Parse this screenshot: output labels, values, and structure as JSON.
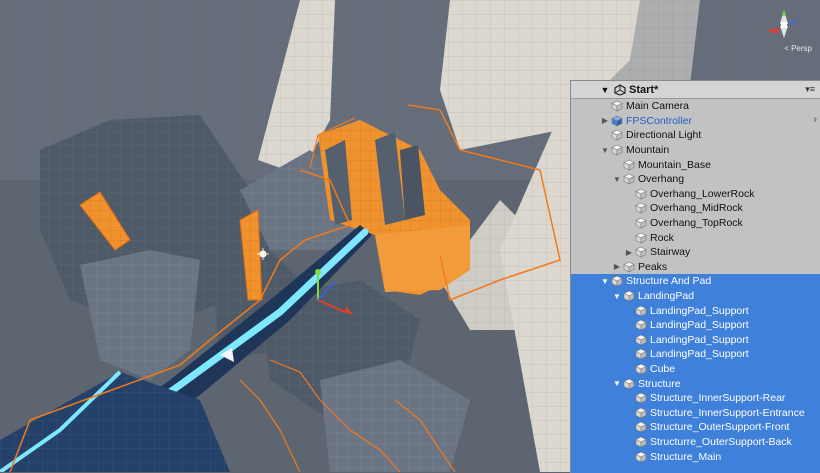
{
  "scene_view": {
    "gizmo_label": "< Persp",
    "colors": {
      "background": "#5f6670",
      "rock_light": "#dedad3",
      "rock_dark": "#4e5866",
      "selection_outline": "#f07a1e",
      "selected_fill": "#f0932e",
      "path_glow": "#7ee8ff"
    }
  },
  "hierarchy": {
    "scene_name": "Start*",
    "items": [
      {
        "label": "Main Camera",
        "depth": 1,
        "arrow": "",
        "selected": false,
        "prefab": false
      },
      {
        "label": "FPSController",
        "depth": 1,
        "arrow": "▶",
        "selected": false,
        "prefab": true
      },
      {
        "label": "Directional Light",
        "depth": 1,
        "arrow": "",
        "selected": false,
        "prefab": false
      },
      {
        "label": "Mountain",
        "depth": 1,
        "arrow": "▼",
        "selected": false,
        "prefab": false
      },
      {
        "label": "Mountain_Base",
        "depth": 2,
        "arrow": "",
        "selected": false,
        "prefab": false
      },
      {
        "label": "Overhang",
        "depth": 2,
        "arrow": "▼",
        "selected": false,
        "prefab": false
      },
      {
        "label": "Overhang_LowerRock",
        "depth": 3,
        "arrow": "",
        "selected": false,
        "prefab": false
      },
      {
        "label": "Overhang_MidRock",
        "depth": 3,
        "arrow": "",
        "selected": false,
        "prefab": false
      },
      {
        "label": "Overhang_TopRock",
        "depth": 3,
        "arrow": "",
        "selected": false,
        "prefab": false
      },
      {
        "label": "Rock",
        "depth": 3,
        "arrow": "",
        "selected": false,
        "prefab": false
      },
      {
        "label": "Stairway",
        "depth": 3,
        "arrow": "▶",
        "selected": false,
        "prefab": false
      },
      {
        "label": "Peaks",
        "depth": 2,
        "arrow": "▶",
        "selected": false,
        "prefab": false
      },
      {
        "label": "Structure And Pad",
        "depth": 1,
        "arrow": "▼",
        "selected": true,
        "prefab": false
      },
      {
        "label": "LandingPad",
        "depth": 2,
        "arrow": "▼",
        "selected": true,
        "prefab": false
      },
      {
        "label": "LandingPad_Support",
        "depth": 3,
        "arrow": "",
        "selected": true,
        "prefab": false
      },
      {
        "label": "LandingPad_Support",
        "depth": 3,
        "arrow": "",
        "selected": true,
        "prefab": false
      },
      {
        "label": "LandingPad_Support",
        "depth": 3,
        "arrow": "",
        "selected": true,
        "prefab": false
      },
      {
        "label": "LandingPad_Support",
        "depth": 3,
        "arrow": "",
        "selected": true,
        "prefab": false
      },
      {
        "label": "Cube",
        "depth": 3,
        "arrow": "",
        "selected": true,
        "prefab": false
      },
      {
        "label": "Structure",
        "depth": 2,
        "arrow": "▼",
        "selected": true,
        "prefab": false
      },
      {
        "label": "Structure_InnerSupport-Rear",
        "depth": 3,
        "arrow": "",
        "selected": true,
        "prefab": false
      },
      {
        "label": "Structure_InnerSupport-Entrance",
        "depth": 3,
        "arrow": "",
        "selected": true,
        "prefab": false
      },
      {
        "label": "Structure_OuterSupport-Front",
        "depth": 3,
        "arrow": "",
        "selected": true,
        "prefab": false
      },
      {
        "label": "Structurre_OuterSupport-Back",
        "depth": 3,
        "arrow": "",
        "selected": true,
        "prefab": false
      },
      {
        "label": "Structure_Main",
        "depth": 3,
        "arrow": "",
        "selected": true,
        "prefab": false
      }
    ]
  }
}
